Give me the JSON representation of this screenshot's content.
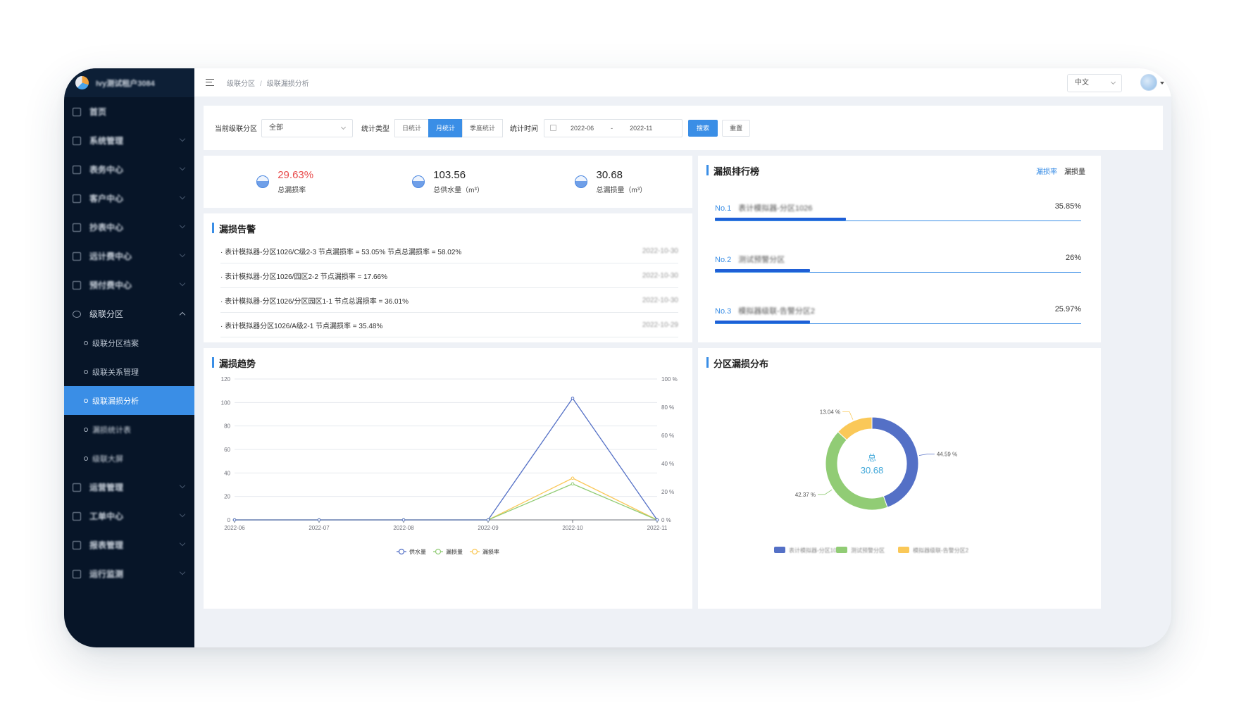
{
  "header": {
    "breadcrumb": [
      "级联分区",
      "级联漏损分析"
    ],
    "breadcrumb_sep": "/",
    "language": "中文"
  },
  "sidebar": {
    "app_name": "Ivy测试租户3084",
    "menu": [
      {
        "label": "首页",
        "icon": "home-icon"
      },
      {
        "label": "系统管理",
        "icon": "gear-icon"
      },
      {
        "label": "表务中心",
        "icon": "meter-icon"
      },
      {
        "label": "客户中心",
        "icon": "user-icon"
      },
      {
        "label": "抄表中心",
        "icon": "book-icon"
      },
      {
        "label": "远计费中心",
        "icon": "box-icon"
      },
      {
        "label": "预付费中心",
        "icon": "box-icon"
      }
    ],
    "open_group": {
      "label": "级联分区",
      "icon": "cascade-icon"
    },
    "sub_items": [
      "级联分区档案",
      "级联关系管理",
      "级联漏损分析",
      "漏损统计表",
      "级联大屏"
    ],
    "active_sub_index": 2,
    "menu_tail": [
      {
        "label": "运营管理",
        "icon": "alert-icon"
      },
      {
        "label": "工单中心",
        "icon": "ticket-icon"
      },
      {
        "label": "报表管理",
        "icon": "report-icon"
      },
      {
        "label": "运行监测",
        "icon": "monitor-icon"
      }
    ]
  },
  "filter": {
    "zone_label": "当前级联分区",
    "zone_value": "全部",
    "type_label": "统计类型",
    "type_options": [
      "日统计",
      "月统计",
      "季度统计"
    ],
    "type_selected": 1,
    "time_label": "统计时间",
    "date_start": "2022-06",
    "date_sep": "-",
    "date_end": "2022-11",
    "search_btn": "搜索",
    "reset_btn": "重置"
  },
  "stats": [
    {
      "value": "29.63%",
      "label": "总漏损率",
      "highlight": "#e84a4a"
    },
    {
      "value": "103.56",
      "label": "总供水量（m³）"
    },
    {
      "value": "30.68",
      "label": "总漏损量（m³）"
    }
  ],
  "alarm": {
    "title": "漏损告警",
    "items": [
      {
        "text": "· 表计模拟器-分区1026/C级2-3 节点漏损率 = 53.05% 节点总漏损率 = 58.02%",
        "date": "2022-10-30"
      },
      {
        "text": "· 表计模拟器-分区1026/园区2-2 节点漏损率 = 17.66%",
        "date": "2022-10-30"
      },
      {
        "text": "· 表计模拟器-分区1026/分区园区1-1 节点总漏损率 = 36.01%",
        "date": "2022-10-30"
      },
      {
        "text": "· 表计模拟器分区1026/A级2-1 节点漏损率 = 35.48%",
        "date": "2022-10-29"
      }
    ]
  },
  "ranking": {
    "title": "漏损排行榜",
    "tabs": [
      "漏损率",
      "漏损量"
    ],
    "tab_selected": 0,
    "rows": [
      {
        "no": "No.1",
        "name": "表计模拟器-分区1026",
        "value": "35.85%",
        "fraction": 0.3585
      },
      {
        "no": "No.2",
        "name": "测试预警分区",
        "value": "26%",
        "fraction": 0.26
      },
      {
        "no": "No.3",
        "name": "模拟器级联-告警分区2",
        "value": "25.97%",
        "fraction": 0.2597
      }
    ]
  },
  "trend": {
    "title": "漏损趋势",
    "chart_data": {
      "type": "line",
      "categories": [
        "2022-06",
        "2022-07",
        "2022-08",
        "2022-09",
        "2022-10",
        "2022-11"
      ],
      "y_left": {
        "range": [
          0,
          120
        ],
        "ticks": [
          0,
          20,
          40,
          60,
          80,
          100,
          120
        ]
      },
      "y_right": {
        "range": [
          0,
          100
        ],
        "ticks": [
          "0 %",
          "20 %",
          "40 %",
          "60 %",
          "80 %",
          "100 %"
        ]
      },
      "series": [
        {
          "name": "供水量",
          "axis": "left",
          "color": "#5470c6",
          "values": [
            0,
            0,
            0,
            0,
            103.56,
            0
          ]
        },
        {
          "name": "漏损量",
          "axis": "left",
          "color": "#91cc75",
          "values": [
            0,
            0,
            0,
            0,
            30.68,
            0
          ]
        },
        {
          "name": "漏损率",
          "axis": "right",
          "color": "#fac858",
          "values": [
            0,
            0,
            0,
            0,
            29.63,
            0
          ]
        }
      ],
      "legend": "bottom-center",
      "grid": true
    }
  },
  "distribution": {
    "title": "分区漏损分布",
    "center_label": "总",
    "center_value": "30.68",
    "chart_data": {
      "type": "pie",
      "donut": true,
      "slices": [
        {
          "name": "表计模拟器-分区1026",
          "value": 44.59,
          "label": "44.59 %",
          "color": "#5470c6"
        },
        {
          "name": "测试预警分区",
          "value": 42.37,
          "label": "42.37 %",
          "color": "#91cc75"
        },
        {
          "name": "模拟器级联-告警分区2",
          "value": 13.04,
          "label": "13.04 %",
          "color": "#fac858"
        }
      ],
      "legend": "bottom-center"
    }
  }
}
